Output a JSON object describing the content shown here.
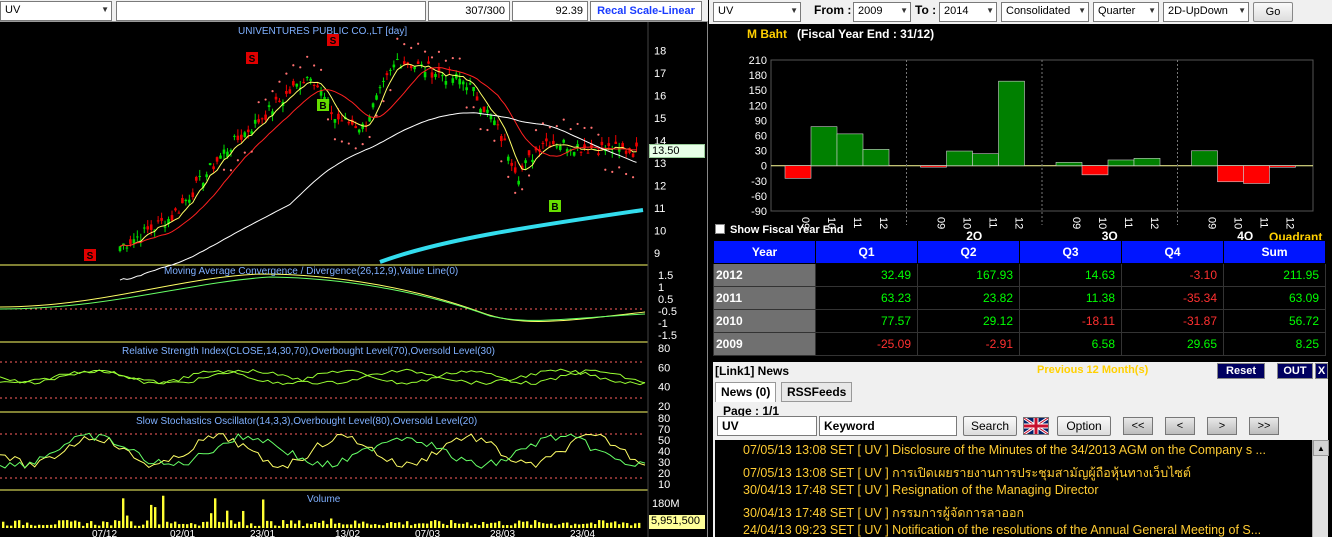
{
  "left": {
    "symbol": "UV",
    "field1": "",
    "count": "307/300",
    "price": "92.39",
    "recal_label": "Recal Scale-Linear",
    "chart_title": "UNIVENTURES PUBLIC CO.,LT [day]",
    "last_price": "13.50",
    "volume_value": "5,951,500",
    "volume_max": "180M",
    "indicators": {
      "macd": "Moving Average Convergence / Divergence(26,12,9),Value Line(0)",
      "rsi": "Relative Strength Index(CLOSE,14,30,70),Overbought Level(70),Oversold Level(30)",
      "stoch": "Slow Stochastics Oscillator(14,3,3),Overbought Level(80),Oversold Level(20)",
      "volume": "Volume"
    },
    "price_axis": [
      "18",
      "17",
      "16",
      "15",
      "14",
      "13",
      "12",
      "11",
      "10",
      "9"
    ],
    "macd_axis": [
      "1.5",
      "1",
      "0.5",
      "-0.5",
      "-1",
      "-1.5"
    ],
    "rsi_axis": [
      "80",
      "60",
      "40",
      "20"
    ],
    "stoch_axis": [
      "80",
      "70",
      "50",
      "40",
      "30",
      "20",
      "10"
    ],
    "date_labels": [
      "07/12",
      "02/01",
      "23/01",
      "13/02",
      "07/03",
      "28/03",
      "23/04"
    ],
    "signals": [
      {
        "text": "S",
        "color": "#e00000"
      },
      {
        "text": "S",
        "color": "#e00000"
      },
      {
        "text": "S",
        "color": "#e00000"
      },
      {
        "text": "B",
        "color": "#66dd00"
      },
      {
        "text": "B",
        "color": "#66dd00"
      }
    ]
  },
  "right": {
    "symbol": "UV",
    "from_label": "From :",
    "from_year": "2009",
    "to_label": "To :",
    "to_year": "2014",
    "consolidation": "Consolidated",
    "period": "Quarter",
    "view": "2D-UpDown",
    "go_label": "Go",
    "chart_title": "M Baht",
    "fiscal_note": "(Fiscal Year End : 31/12)",
    "show_fiscal_label": "Show Fiscal Year End",
    "quadrant_label": "Quadrant"
  },
  "chart_data": {
    "type": "bar",
    "title": "M Baht",
    "subtitle": "(Fiscal Year End : 31/12)",
    "ylim": [
      -90,
      210
    ],
    "yticks": [
      210,
      180,
      150,
      120,
      90,
      60,
      30,
      0,
      -30,
      -60,
      -90
    ],
    "groups": [
      "1Q",
      "2Q",
      "3Q",
      "4Q"
    ],
    "categories": [
      "09",
      "10",
      "11",
      "12"
    ],
    "series": [
      {
        "name": "1Q",
        "values": [
          -25.09,
          77.57,
          63.23,
          32.49
        ]
      },
      {
        "name": "2Q",
        "values": [
          -2.91,
          29.12,
          23.82,
          167.93
        ]
      },
      {
        "name": "3Q",
        "values": [
          6.58,
          -18.11,
          11.38,
          14.63
        ]
      },
      {
        "name": "4Q",
        "values": [
          29.65,
          -31.87,
          -35.34,
          -3.1
        ]
      }
    ],
    "group_labels": [
      "",
      "2Q",
      "3Q",
      "4Q"
    ],
    "quadrant_label": "Quadrant"
  },
  "table": {
    "headers": [
      "Year",
      "Q1",
      "Q2",
      "Q3",
      "Q4",
      "Sum"
    ],
    "rows": [
      {
        "year": "2012",
        "q1": "32.49",
        "q2": "167.93",
        "q3": "14.63",
        "q4": "-3.10",
        "sum": "211.95"
      },
      {
        "year": "2011",
        "q1": "63.23",
        "q2": "23.82",
        "q3": "11.38",
        "q4": "-35.34",
        "sum": "63.09"
      },
      {
        "year": "2010",
        "q1": "77.57",
        "q2": "29.12",
        "q3": "-18.11",
        "q4": "-31.87",
        "sum": "56.72"
      },
      {
        "year": "2009",
        "q1": "-25.09",
        "q2": "-2.91",
        "q3": "6.58",
        "q4": "29.65",
        "sum": "8.25"
      }
    ]
  },
  "news": {
    "title": "[Link1] News",
    "previous": "Previous 12 Month(s)",
    "reset": "Reset",
    "out": "OUT",
    "close": "X",
    "tab_news": "News (0)",
    "tab_rss": "RSSFeeds",
    "page": "Page : 1/1",
    "symbol": "UV",
    "keyword_placeholder": "Keyword",
    "search_label": "Search",
    "option_label": "Option",
    "nav": [
      "<<",
      "<",
      ">",
      ">>"
    ],
    "items": [
      "07/05/13 13:08  SET  [ UV ]  Disclosure of the Minutes of the 34/2013 AGM on the Company s ...",
      "07/05/13 13:08  SET  [ UV ]  การเปิดเผยรายงานการประชุมสามัญผู้ถือหุ้นทางเว็บไซต์",
      "30/04/13 17:48  SET  [ UV ]  Resignation of the Managing Director",
      "30/04/13 17:48  SET  [ UV ]  กรรมการผู้จัดการลาออก",
      "24/04/13 09:23  SET  [ UV ]  Notification of the resolutions of the Annual General Meeting of S..."
    ]
  }
}
